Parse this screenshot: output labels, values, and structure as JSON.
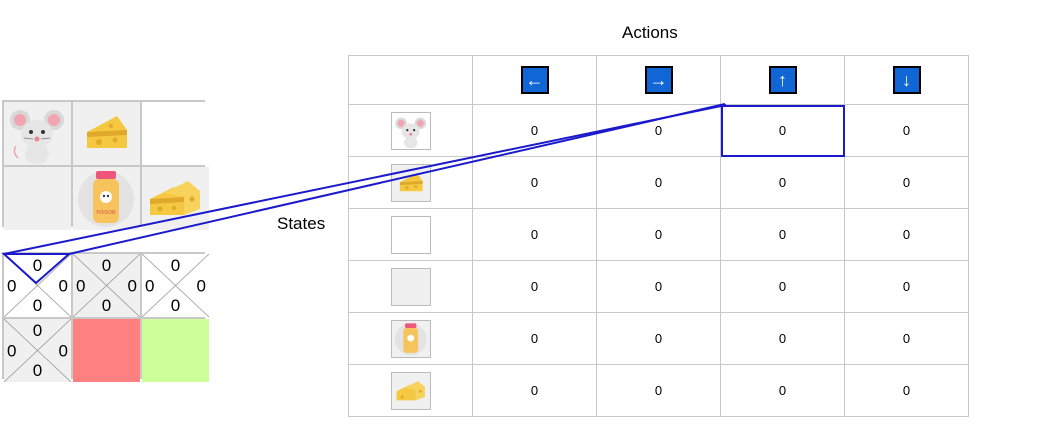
{
  "labels": {
    "actions": "Actions",
    "states": "States"
  },
  "environment": {
    "cells": [
      {
        "content": "mouse-icon",
        "background": "#f0f0f0"
      },
      {
        "content": "cheese-icon",
        "background": "#f0f0f0"
      },
      {
        "content": "empty",
        "background": "#ffffff"
      },
      {
        "content": "empty",
        "background": "#f0f0f0"
      },
      {
        "content": "poison-icon",
        "background": "#f0f0f0",
        "label": "POISON"
      },
      {
        "content": "big-cheese-icon",
        "background": "#f0f0f0"
      }
    ]
  },
  "q_grid": {
    "cells": [
      {
        "top": "0",
        "left": "0",
        "right": "0",
        "bottom": "0",
        "type": "q",
        "highlighted": true
      },
      {
        "top": "0",
        "left": "0",
        "right": "0",
        "bottom": "0",
        "type": "q"
      },
      {
        "top": "0",
        "left": "0",
        "right": "0",
        "bottom": "0",
        "type": "q"
      },
      {
        "top": "0",
        "left": "0",
        "right": "0",
        "bottom": "0",
        "type": "q"
      },
      {
        "type": "poison",
        "color": "#ff8080"
      },
      {
        "type": "goal",
        "color": "#ccff99"
      }
    ]
  },
  "q_table": {
    "actions": [
      {
        "name": "left",
        "glyph": "←"
      },
      {
        "name": "right",
        "glyph": "→"
      },
      {
        "name": "up",
        "glyph": "↑"
      },
      {
        "name": "down",
        "glyph": "↓"
      }
    ],
    "rows": [
      {
        "state": "mouse-icon",
        "values": [
          "0",
          "0",
          "0",
          "0"
        ]
      },
      {
        "state": "cheese-icon",
        "values": [
          "0",
          "0",
          "0",
          "0"
        ]
      },
      {
        "state": "empty-white",
        "values": [
          "0",
          "0",
          "0",
          "0"
        ]
      },
      {
        "state": "empty-grey",
        "values": [
          "0",
          "0",
          "0",
          "0"
        ]
      },
      {
        "state": "poison-icon",
        "values": [
          "0",
          "0",
          "0",
          "0"
        ]
      },
      {
        "state": "big-cheese-icon",
        "values": [
          "0",
          "0",
          "0",
          "0"
        ]
      }
    ],
    "highlight": {
      "row": 0,
      "action": "up"
    }
  },
  "colors": {
    "action_button": "#1166d6",
    "highlight": "#1a1acc",
    "poison_cell": "#ff8080",
    "goal_cell": "#ccff99",
    "cheese": "#f5c842"
  }
}
